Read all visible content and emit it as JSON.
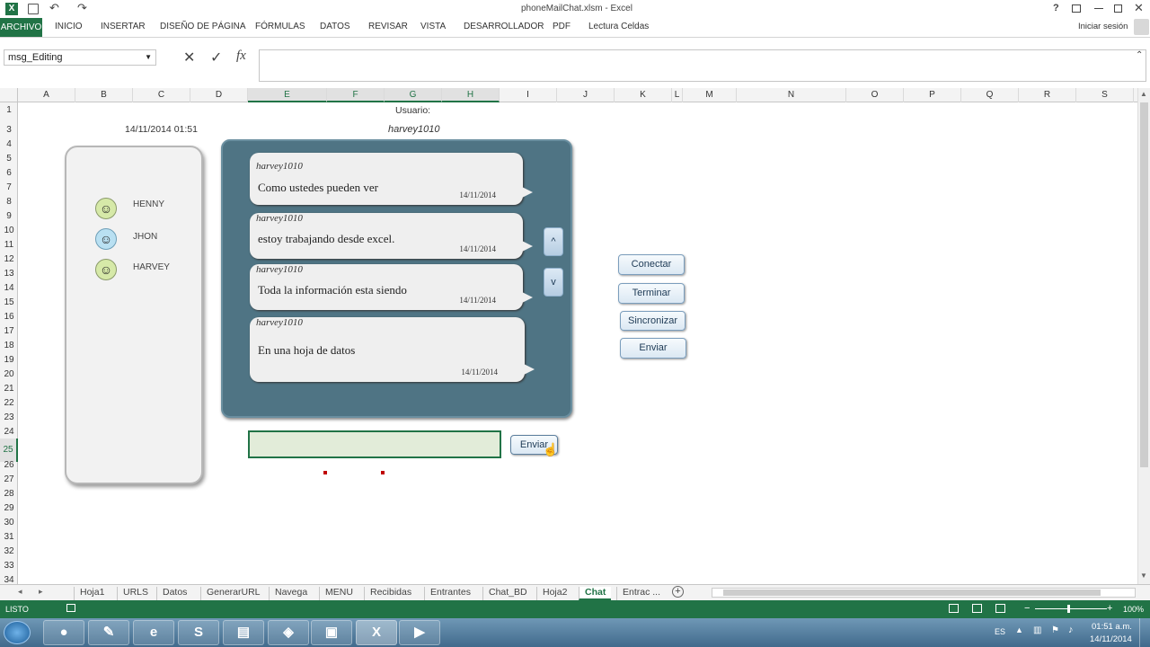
{
  "window": {
    "title": "phoneMailChat.xlsm - Excel",
    "help_icon": "?",
    "sign_in": "Iniciar sesión"
  },
  "ribbon": {
    "tabs": [
      "ARCHIVO",
      "INICIO",
      "INSERTAR",
      "DISEÑO DE PÁGINA",
      "FÓRMULAS",
      "DATOS",
      "REVISAR",
      "VISTA",
      "DESARROLLADOR",
      "PDF",
      "Lectura Celdas"
    ]
  },
  "formula_bar": {
    "name_box": "msg_Editing",
    "fx": "fx",
    "formula": ""
  },
  "columns": [
    "A",
    "B",
    "C",
    "D",
    "E",
    "F",
    "G",
    "H",
    "I",
    "J",
    "K",
    "L",
    "M",
    "N",
    "O",
    "P",
    "Q",
    "R",
    "S"
  ],
  "rows": [
    "1",
    "3",
    "4",
    "5",
    "6",
    "7",
    "8",
    "9",
    "10",
    "11",
    "12",
    "13",
    "14",
    "15",
    "16",
    "17",
    "18",
    "19",
    "20",
    "21",
    "22",
    "23",
    "24",
    "25",
    "26",
    "27",
    "28",
    "29",
    "30",
    "31",
    "32",
    "33",
    "34"
  ],
  "sheet": {
    "timestamp": "14/11/2014 01:51",
    "user_label": "Usuario:",
    "user_value": "harvey1010"
  },
  "contacts": [
    {
      "name": "HENNY",
      "color": "#d6e9a8"
    },
    {
      "name": "JHON",
      "color": "#b9e0f2"
    },
    {
      "name": "HARVEY",
      "color": "#d6e9a8"
    }
  ],
  "messages": [
    {
      "user": "harvey1010",
      "text": "Como ustedes pueden ver",
      "date": "14/11/2014"
    },
    {
      "user": "harvey1010",
      "text": "estoy trabajando desde excel.",
      "date": "14/11/2014"
    },
    {
      "user": "harvey1010",
      "text": "Toda la información esta siendo",
      "date": "14/11/2014"
    },
    {
      "user": "harvey1010",
      "text": "En una hoja de datos",
      "date": "14/11/2014"
    }
  ],
  "scroll_buttons": {
    "up": "^",
    "down": "v"
  },
  "side_buttons": [
    "Conectar",
    "Terminar",
    "Sincronizar",
    "Enviar"
  ],
  "send_button": "Enviar",
  "message_input": "",
  "sheet_tabs": [
    "Hoja1",
    "URLS",
    "Datos",
    "GenerarURL",
    "Navega",
    "MENU",
    "Recibidas",
    "Entrantes",
    "Chat_BD",
    "Hoja2",
    "Chat",
    "Entrac ..."
  ],
  "active_sheet": "Chat",
  "status": {
    "ready": "LISTO",
    "zoom": "100%"
  },
  "taskbar": {
    "lang": "ES",
    "time": "01:51 a.m.",
    "date": "14/11/2014"
  },
  "colors": {
    "excel_green": "#217346",
    "chat_panel": "#4f7484"
  }
}
